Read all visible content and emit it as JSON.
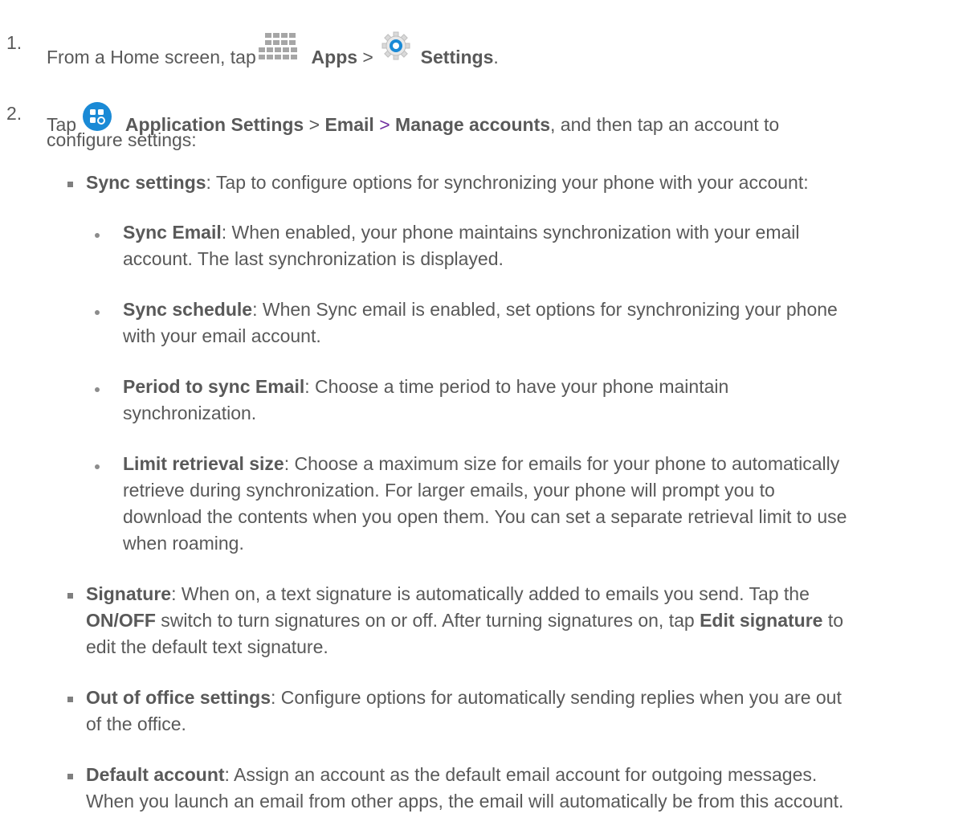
{
  "steps": [
    {
      "num": "1.",
      "pre": "From a Home screen, tap ",
      "apps_label": "Apps",
      "sep": " > ",
      "settings_label": "Settings",
      "post": "."
    },
    {
      "num": "2.",
      "pre": "Tap ",
      "app_settings_label": "Application Settings",
      "sep1": " > ",
      "email_label": "Email",
      "sep2": " > ",
      "manage_label": "Manage accounts",
      "post_line1": ", and then tap an account to",
      "post_line2": "configure settings:"
    }
  ],
  "items": {
    "sync": {
      "title": "Sync settings",
      "text": ": Tap to configure options for synchronizing your phone with your account:"
    },
    "sync_email": {
      "title": "Sync Email",
      "line1": ": When enabled, your phone maintains synchronization with your email",
      "line2": "account. The last synchronization is displayed."
    },
    "sync_schedule": {
      "title": "Sync schedule",
      "line1": ": When Sync email is enabled, set options for synchronizing your phone",
      "line2": "with your email account."
    },
    "period": {
      "title": "Period to sync Email",
      "line1": ": Choose a time period to have your phone maintain",
      "line2": "synchronization."
    },
    "limit": {
      "title": "Limit retrieval size",
      "line1": ": Choose a maximum size for emails for your phone to automatically",
      "line2": "retrieve during synchronization. For larger emails, your phone will prompt you to",
      "line3": "download the contents when you open them. You can set a separate retrieval limit to use",
      "line4": "when roaming."
    },
    "signature": {
      "title": "Signature",
      "line1_a": ": When on, a text signature is automatically added to emails you send. Tap the",
      "onoff": "ON/OFF",
      "line2_a": " switch to turn signatures on or off. After turning signatures on, tap ",
      "edit_sig": "Edit signature",
      "line2_b": " to",
      "line3": "edit the default text signature."
    },
    "ooo": {
      "title": "Out of office settings",
      "line1": ": Configure options for automatically sending replies when you are out",
      "line2": "of the office."
    },
    "default": {
      "title": "Default account",
      "line1": ": Assign an account as the default email account for outgoing messages.",
      "line2": "When you launch an email from other apps, the email will automatically be from this account."
    }
  },
  "colors": {
    "text": "#595959",
    "accent_separator": "#7030a0",
    "app_settings_icon": "#1a8ad6"
  },
  "icons": [
    "apps-grid-icon",
    "settings-gear-icon",
    "application-settings-icon"
  ]
}
